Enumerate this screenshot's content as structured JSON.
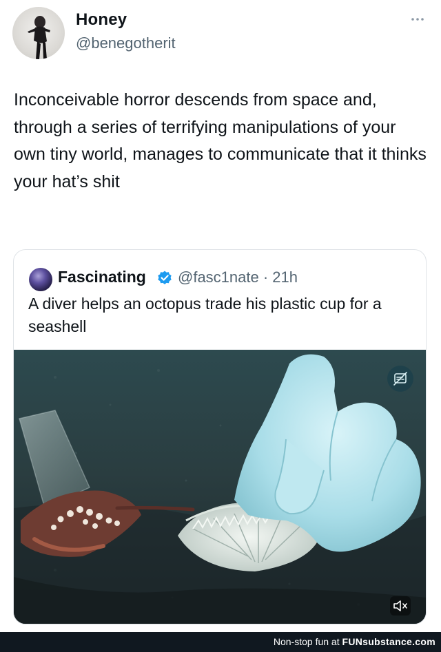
{
  "tweet": {
    "author_name": "Honey",
    "author_handle": "@benegotherit",
    "text": "Inconceivable horror descends from space and, through a series of terrifying manipulations of your own tiny world, manages to communicate that it thinks your hat’s shit"
  },
  "quote": {
    "author_name": "Fascinating",
    "author_handle": "@fasc1nate · 21h",
    "text": "A diver helps an octopus trade his plastic cup for a seashell",
    "verified_color": "#1d9bf0"
  },
  "footer": {
    "tagline": "Non-stop fun at",
    "brand": "FUNsubstance.com"
  },
  "icons": [
    "more-icon",
    "verified-icon",
    "alt-badge-icon",
    "mute-icon"
  ]
}
